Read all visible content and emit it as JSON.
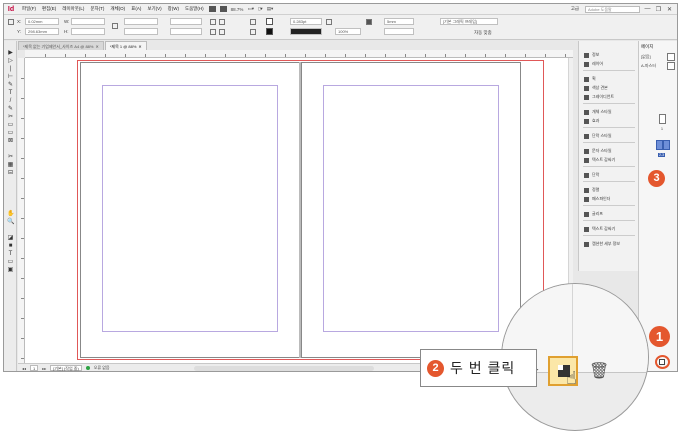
{
  "app": {
    "logo": "Id",
    "menus": [
      "파일(F)",
      "편집(E)",
      "레이아웃(L)",
      "문자(T)",
      "개체(O)",
      "표(A)",
      "보기(V)",
      "창(W)",
      "도움말(H)"
    ],
    "mini_labels": [
      "Br",
      "St"
    ],
    "zoom": "88.7%",
    "workspace": "고급",
    "search_placeholder": "Adobe 도움말",
    "win_controls": [
      "—",
      "❐",
      "✕"
    ]
  },
  "control_panel": {
    "x_label": "X:",
    "x_value": "0.02mm",
    "y_label": "Y:",
    "y_value": "298.63mm",
    "w_label": "W:",
    "h_label": "H:",
    "stroke_weight": "0.283pt",
    "percent_value": "100%",
    "size_value": "5mm",
    "style_value": "[기본 그래픽 프레임]",
    "auto_fit": "자동 맞춤"
  },
  "doc_tabs": [
    {
      "label": "*제목 없는 기업제안서_사이즈 A4 @ 88%",
      "active": false,
      "close": "✕"
    },
    {
      "label": "*제목 1 @ 88%",
      "active": true,
      "close": "✕"
    }
  ],
  "tools": [
    "▶",
    "▷",
    "|",
    "⊢",
    "✎",
    "T",
    "/",
    "✎",
    "✂",
    "▭",
    "▭",
    "⊠",
    "✂",
    "▦",
    "⊟",
    "✋",
    "🔍",
    "◪",
    "■",
    "T",
    "▭",
    "▣"
  ],
  "statusbar": {
    "page_field": "1",
    "style_field": "[기본] (작업 중)",
    "status_text": "오류 없음"
  },
  "panels": [
    {
      "label": "정보"
    },
    {
      "label": "레이어"
    },
    {
      "label": "획"
    },
    {
      "label": "색상 견본"
    },
    {
      "label": "그레이디언트"
    },
    {
      "label": "개체 스타일"
    },
    {
      "label": "효과"
    },
    {
      "label": "단락 스타일"
    },
    {
      "label": "문자 스타일"
    },
    {
      "label": "텍스트 감싸기"
    },
    {
      "label": "단락"
    },
    {
      "label": "정렬"
    },
    {
      "label": "패스파인더"
    },
    {
      "label": "글리프"
    },
    {
      "label": "텍스트 감싸기"
    },
    {
      "label": "캡션한 세부 정보"
    }
  ],
  "pages_panel": {
    "tab": "페이지",
    "master_none": "[없음]",
    "master_a": "A-마스터",
    "page_1": "1",
    "spread_label": "2-3"
  },
  "callouts": {
    "step1": "1",
    "step2_number": "2",
    "step2_text": "두 번 클릭",
    "step3": "3"
  },
  "icons": {
    "new_page": "new-page-icon",
    "trash": "🗑",
    "hand": "☝",
    "arrow": "▸"
  }
}
